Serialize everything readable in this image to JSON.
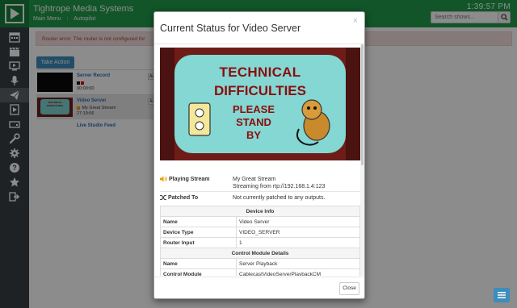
{
  "header": {
    "brand": "Tightrope Media Systems",
    "menu": [
      "Main Menu",
      ":",
      "Autopilot"
    ],
    "clock": "1:39:57 PM",
    "search_placeholder": "Search shows..."
  },
  "sidebar": {
    "icons": [
      "calendar-icon",
      "clapperboard-icon",
      "monitor-icon",
      "microphone-icon",
      "paper-plane-icon",
      "file-video-icon",
      "hdd-icon",
      "wrench-icon",
      "gear-icon",
      "question-icon",
      "star-icon",
      "sign-out-icon"
    ],
    "active_index": 4
  },
  "background": {
    "alert": "Router error: The router is not configured for",
    "take_action": "Take Action",
    "devices": [
      {
        "name": "Server Record",
        "meta": [
          "00:00:00"
        ],
        "action": "Action"
      },
      {
        "name": "Video Server",
        "meta": [
          "My Great Stream",
          "27:19:06"
        ],
        "action": "Action"
      }
    ],
    "live_feed": "Live Studio Feed"
  },
  "modal": {
    "title": "Current Status for Video Server",
    "close_x": "×",
    "preview_text": [
      "TECHNICAL",
      "DIFFICULTIES",
      "PLEASE",
      "STAND",
      "BY"
    ],
    "playing_stream_label": "Playing Stream",
    "playing_stream_value": "My Great Stream",
    "playing_stream_source": "Streaming from rtp://192.168.1.4:123",
    "patched_to_label": "Patched To",
    "patched_to_value": "Not currently patched to any outputs.",
    "device_info": {
      "header": "Device Info",
      "rows": [
        {
          "k": "Name",
          "v": "Video Server"
        },
        {
          "k": "Device Type",
          "v": "VIDEO_SERVER"
        },
        {
          "k": "Router Input",
          "v": "1"
        }
      ]
    },
    "control_module": {
      "header": "Control Module Details",
      "rows": [
        {
          "k": "Name",
          "v": "Server Playback"
        },
        {
          "k": "Control Module",
          "v": "CablecastVideoServerPlaybackCM"
        }
      ]
    },
    "close_button": "Close"
  },
  "colors": {
    "header_green": "#1f9b4a",
    "sidebar_dark": "#3a3f44",
    "link_blue": "#2a6eb8",
    "button_blue": "#3c8dbc",
    "alert_bg": "#f2dede"
  }
}
